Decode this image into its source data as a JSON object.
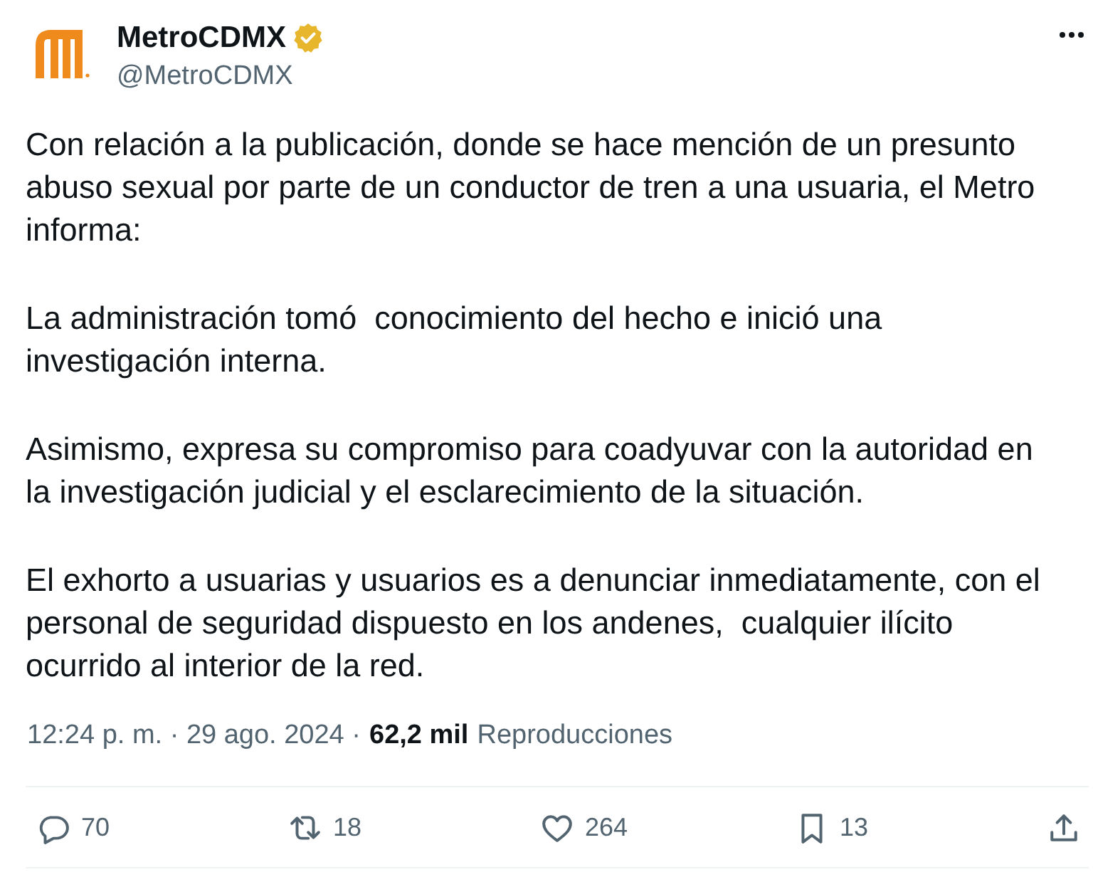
{
  "author": {
    "name": "MetroCDMX",
    "verified": true,
    "handle": "@MetroCDMX"
  },
  "body": {
    "paragraphs": [
      [
        "Con relación a la publicación, donde se hace mención de un presunto",
        "abuso sexual por parte de un conductor de tren a una usuaria, el Metro",
        "informa:"
      ],
      [
        "La administración tomó  conocimiento del hecho e inició una",
        "investigación interna."
      ],
      [
        "Asimismo, expresa su compromiso para coadyuvar con la autoridad en",
        "la investigación judicial y el esclarecimiento de la situación."
      ],
      [
        "El exhorto a usuarias y usuarios es a denunciar inmediatamente, con el",
        "personal de seguridad dispuesto en los andenes,  cualquier ilícito",
        "ocurrido al interior de la red."
      ]
    ]
  },
  "meta": {
    "timestamp": "12:24 p. m. · 29 ago. 2024 ·",
    "views": "62,2 mil",
    "views_label": "Reproducciones"
  },
  "actions": [
    {
      "kind": "reply",
      "count": "70"
    },
    {
      "kind": "repost",
      "count": "18"
    },
    {
      "kind": "like",
      "count": "264"
    },
    {
      "kind": "bookmark",
      "count": "13"
    },
    {
      "kind": "share"
    }
  ]
}
